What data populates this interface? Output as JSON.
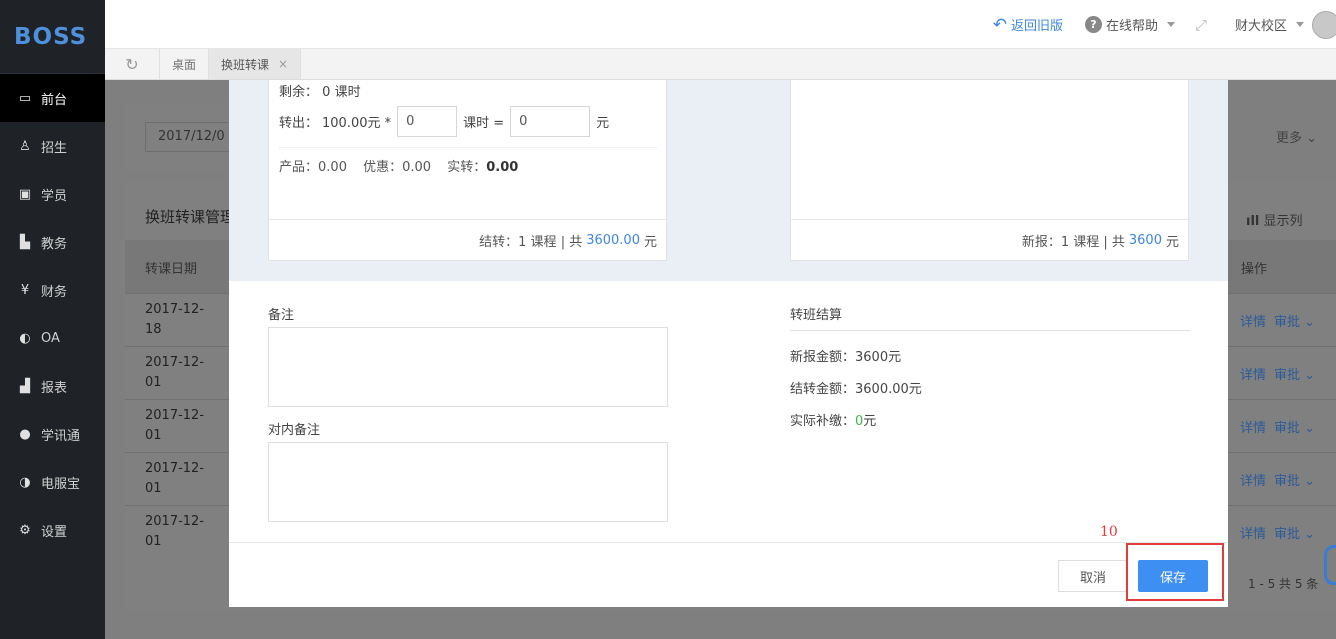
{
  "app": {
    "logo": "BOSS"
  },
  "sidebar": {
    "items": [
      {
        "label": "前台",
        "icon": "calendar-icon",
        "glyph": "▭"
      },
      {
        "label": "招生",
        "icon": "user-add-icon",
        "glyph": "♙"
      },
      {
        "label": "学员",
        "icon": "id-card-icon",
        "glyph": "▣"
      },
      {
        "label": "教务",
        "icon": "book-icon",
        "glyph": "▙"
      },
      {
        "label": "财务",
        "icon": "yen-icon",
        "glyph": "¥"
      },
      {
        "label": "OA",
        "icon": "toggle-icon",
        "glyph": "◐"
      },
      {
        "label": "报表",
        "icon": "bar-chart-icon",
        "glyph": "▟"
      },
      {
        "label": "学讯通",
        "icon": "location-icon",
        "glyph": "●"
      },
      {
        "label": "电服宝",
        "icon": "phone-icon",
        "glyph": "◑"
      },
      {
        "label": "设置",
        "icon": "gear-icon",
        "glyph": "⚙"
      }
    ]
  },
  "topbar": {
    "back_label": "返回旧版",
    "help_label": "在线帮助",
    "campus_label": "财大校区"
  },
  "tabs": [
    {
      "label": "桌面"
    },
    {
      "label": "换班转课",
      "close": "×"
    }
  ],
  "background": {
    "date_value": "2017/12/0",
    "more_label": "更多",
    "card_title": "换班转课管理",
    "show_columns_label": "显示列",
    "col_date": "转课日期",
    "col_ops": "操作",
    "rows": [
      {
        "date": "2017-12-18",
        "detail": "详情",
        "approve": "审批"
      },
      {
        "date": "2017-12-01",
        "detail": "详情",
        "approve": "审批"
      },
      {
        "date": "2017-12-01",
        "detail": "详情",
        "approve": "审批"
      },
      {
        "date": "2017-12-01",
        "detail": "详情",
        "approve": "审批"
      },
      {
        "date": "2017-12-01",
        "detail": "详情",
        "approve": "审批"
      }
    ],
    "pager": "1 - 5   共 5 条"
  },
  "modal": {
    "left_panel": {
      "remain_label": "剩余：",
      "remain_value": "0",
      "remain_unit": "课时",
      "out_label": "转出：",
      "out_price": "100.00元 *",
      "hours_value": "0",
      "hours_unit": "课时 =",
      "amount_value": "0",
      "amount_unit": "元",
      "product_label": "产品：",
      "product_value": "0.00",
      "discount_label": "优惠：",
      "discount_value": "0.00",
      "actual_label": "实转：",
      "actual_value": "0.00",
      "footer_prefix": "结转：1 课程 | 共",
      "footer_amount": "3600.00",
      "footer_suffix": "元"
    },
    "right_panel": {
      "footer_prefix": "新报：1 课程 | 共",
      "footer_amount": "3600",
      "footer_suffix": "元"
    },
    "remark_label": "备注",
    "internal_remark_label": "对内备注",
    "settlement": {
      "title": "转班结算",
      "new_label": "新报金额：",
      "new_value": "3600元",
      "carry_label": "结转金额：",
      "carry_value": "3600.00元",
      "pay_label": "实际补缴：",
      "pay_value": "0",
      "pay_unit": "元"
    },
    "cancel_label": "取消",
    "save_label": "保存"
  },
  "annotation": {
    "number": "10"
  }
}
